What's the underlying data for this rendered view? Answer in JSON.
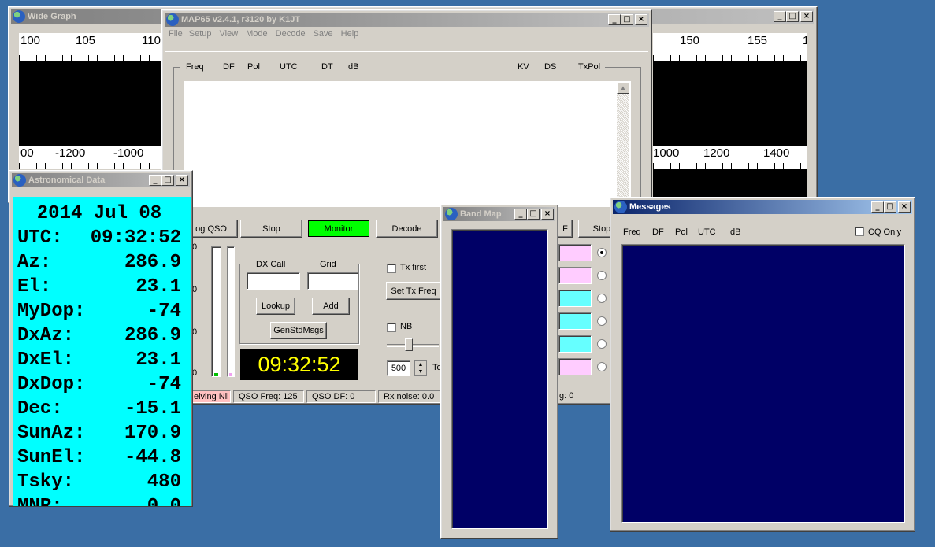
{
  "wide_graph": {
    "title": "Wide Graph",
    "top_scale_left": [
      "100",
      "105",
      "110"
    ],
    "top_scale_right": [
      "150",
      "155",
      "1"
    ],
    "bottom_scale_left": [
      "00",
      "-1200",
      "-1000"
    ],
    "bottom_scale_right": [
      "1000",
      "1200",
      "1400"
    ]
  },
  "map65": {
    "title": "MAP65   v2.4.1, r3120   by K1JT",
    "menu": [
      "File",
      "Setup",
      "View",
      "Mode",
      "Decode",
      "Save",
      "Help"
    ],
    "columns": [
      "Freq",
      "DF",
      "Pol",
      "UTC",
      "DT",
      "dB",
      "KV",
      "DS",
      "TxPol"
    ],
    "buttons": {
      "log_qso": "Log QSO",
      "stop": "Stop",
      "monitor": "Monitor",
      "decode": "Decode",
      "erase": "F",
      "stop2": "Stop"
    },
    "dx_call_label": "DX  Call",
    "grid_label": "Grid",
    "lookup": "Lookup",
    "add": "Add",
    "genstd": "GenStdMsgs",
    "clock": "09:32:52",
    "tx_first": "Tx first",
    "set_tx_freq": "Set Tx Freq",
    "nb": "NB",
    "spin_value": "500",
    "to_label": "To",
    "level_labels": [
      "0",
      "0",
      "0",
      "0"
    ],
    "status": [
      "eiving Nil",
      "QSO Freq:   125",
      "QSO DF:   0",
      "Rx noise:    0.0",
      "g: 0"
    ],
    "monitor_color": "#00ff00"
  },
  "astro": {
    "title": "Astronomical Data",
    "date": "2014 Jul 08",
    "rows": [
      [
        "UTC:",
        "09:32:52"
      ],
      [
        "Az:",
        "286.9"
      ],
      [
        "El:",
        "23.1"
      ],
      [
        "MyDop:",
        "-74"
      ],
      [
        "DxAz:",
        "286.9"
      ],
      [
        "DxEl:",
        "23.1"
      ],
      [
        "DxDop:",
        "-74"
      ],
      [
        "Dec:",
        "-15.1"
      ],
      [
        "SunAz:",
        "170.9"
      ],
      [
        "SunEl:",
        "-44.8"
      ],
      [
        "Tsky:",
        "480"
      ],
      [
        "MNR:",
        "0.0"
      ]
    ],
    "bg_color": "#00ffff"
  },
  "band_map": {
    "title": "Band Map"
  },
  "messages": {
    "title": "Messages",
    "columns": [
      "Freq",
      "DF",
      "Pol",
      "UTC",
      "dB"
    ],
    "cq_only": "CQ Only"
  }
}
